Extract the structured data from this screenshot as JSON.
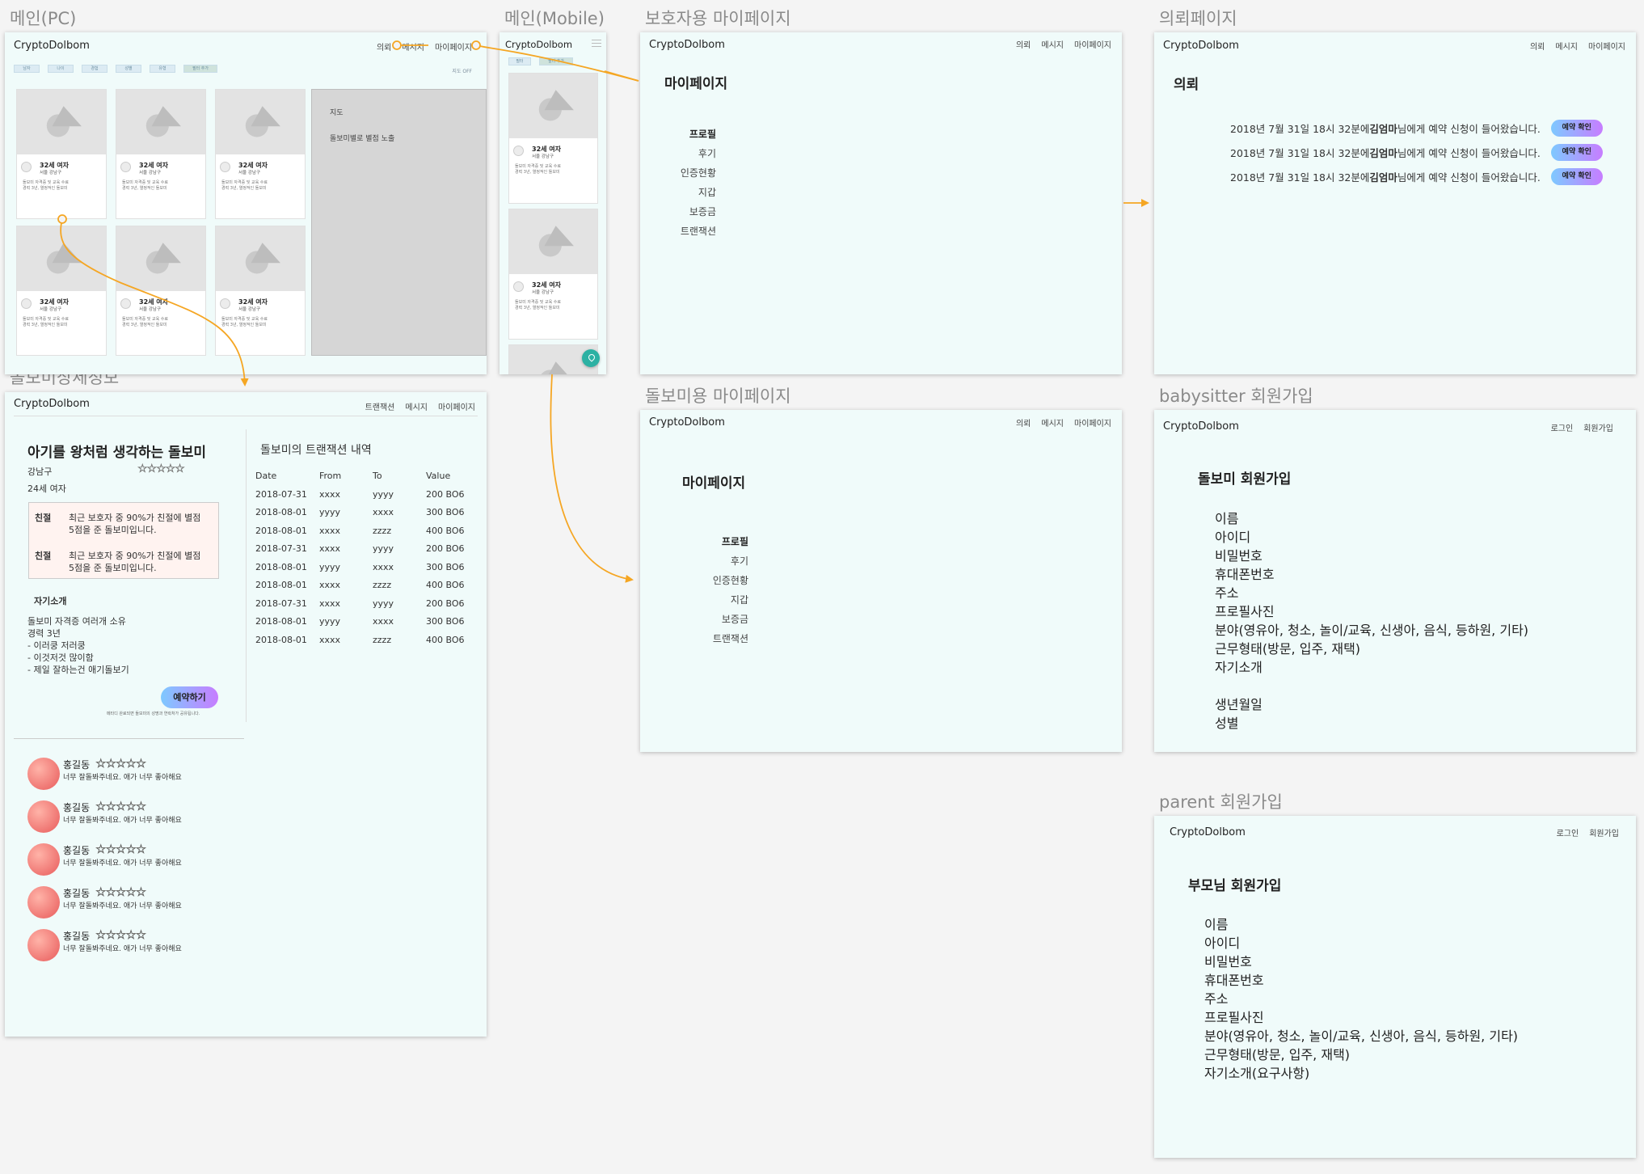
{
  "artboard_labels": {
    "main_pc": "메인(PC)",
    "main_mobile": "메인(Mobile)",
    "guardian_mypage": "보호자용 마이페이지",
    "request_page": "의뢰페이지",
    "sitter_detail": "돌보미상세정보",
    "sitter_mypage": "돌보미용 마이페이지",
    "babysitter_signup": "babysitter 회원가입",
    "parent_signup": "parent 회원가입"
  },
  "brand": "CryptoDolbom",
  "nav": {
    "request": "의뢰",
    "message": "메시지",
    "mypage": "마이페이지",
    "transaction": "트랜잭션",
    "login": "로그인",
    "signup": "회원가입"
  },
  "main_pc": {
    "filters": [
      "남자",
      "나이",
      "경험",
      "성별",
      "유형",
      "필터 추가"
    ],
    "toggle": "지도 OFF",
    "card": {
      "title": "32세 여자",
      "location": "서울 강남구",
      "desc1": "돌보미 자격증 및 교육 수료",
      "desc2": "경력 3년, 열정적인 돌보미"
    },
    "map": {
      "title": "지도",
      "note": "돌보미별로 별점 노출"
    }
  },
  "main_mobile": {
    "filters": [
      "필터",
      "필터 추가"
    ],
    "card": {
      "title": "32세 여자",
      "location": "서울 강남구",
      "desc1": "돌보미 자격증 및 교육 수료",
      "desc2": "경력 3년, 열정적인 돌보미"
    }
  },
  "mypage": {
    "title": "마이페이지",
    "menu": [
      "프로필",
      "후기",
      "인증현황",
      "지갑",
      "보증금",
      "트랜잭션"
    ]
  },
  "request_page": {
    "title": "의뢰",
    "rows": [
      {
        "pre": "2018년 7월 31일 18시 32분에 ",
        "name": "김엄마",
        "post": "님에게 예약 신청이 들어왔습니다.",
        "button": "예약 확인"
      },
      {
        "pre": "2018년 7월 31일 18시 32분에 ",
        "name": "김엄마",
        "post": "님에게 예약 신청이 들어왔습니다.",
        "button": "예약 확인"
      },
      {
        "pre": "2018년 7월 31일 18시 32분에 ",
        "name": "김엄마",
        "post": "님에게 예약 신청이 들어왔습니다.",
        "button": "예약 확인"
      }
    ]
  },
  "detail": {
    "headline": "아기를 왕처럼 생각하는 돌보미",
    "location": "강남구",
    "age_gender": "24세 여자",
    "rating_stars": 5,
    "notes": [
      {
        "tag": "친절",
        "line1": "최근 보호자 중 90%가 친절에 별점",
        "line2": "5점을 준 돌보미입니다."
      },
      {
        "tag": "친절",
        "line1": "최근 보호자 중 90%가 친절에 별점",
        "line2": "5점을 준 돌보미입니다."
      }
    ],
    "intro_title": "자기소개",
    "intro_lines": [
      "돌보미 자격증 여러개 소유",
      "경력 3년",
      "- 이러쿵 저러쿵",
      "- 이것저것 많이함",
      "- 제일 잘하는건 애기돌보기"
    ],
    "book_button": "예약하기",
    "book_note": "메타디 완료되면 돌보미의 성명과 연락처가 공유됩니다.",
    "tx_title": "돌보미의 트랜잭션 내역",
    "tx_headers": [
      "Date",
      "From",
      "To",
      "Value"
    ],
    "tx_rows": [
      [
        "2018-07-31",
        "xxxx",
        "yyyy",
        "200 BO6"
      ],
      [
        "2018-08-01",
        "yyyy",
        "xxxx",
        "300 BO6"
      ],
      [
        "2018-08-01",
        "xxxx",
        "zzzz",
        "400 BO6"
      ],
      [
        "2018-07-31",
        "xxxx",
        "yyyy",
        "200 BO6"
      ],
      [
        "2018-08-01",
        "yyyy",
        "xxxx",
        "300 BO6"
      ],
      [
        "2018-08-01",
        "xxxx",
        "zzzz",
        "400 BO6"
      ],
      [
        "2018-07-31",
        "xxxx",
        "yyyy",
        "200 BO6"
      ],
      [
        "2018-08-01",
        "yyyy",
        "xxxx",
        "300 BO6"
      ],
      [
        "2018-08-01",
        "xxxx",
        "zzzz",
        "400 BO6"
      ]
    ],
    "reviews": [
      {
        "name": "홍길동",
        "comment": "너무 잘돌봐주네요. 애가 너무 좋아해요",
        "stars": 5
      },
      {
        "name": "홍길동",
        "comment": "너무 잘돌봐주네요. 애가 너무 좋아해요",
        "stars": 5
      },
      {
        "name": "홍길동",
        "comment": "너무 잘돌봐주네요. 애가 너무 좋아해요",
        "stars": 5
      },
      {
        "name": "홍길동",
        "comment": "너무 잘돌봐주네요. 애가 너무 좋아해요",
        "stars": 5
      },
      {
        "name": "홍길동",
        "comment": "너무 잘돌봐주네요. 애가 너무 좋아해요",
        "stars": 5
      }
    ]
  },
  "sitter_signup": {
    "title": "돌보미 회원가입",
    "fields": [
      "이름",
      "아이디",
      "비밀번호",
      "휴대폰번호",
      "주소",
      "프로필사진",
      "분야(영유아, 청소, 놀이/교육, 신생아, 음식, 등하원, 기타)",
      "근무형태(방문, 입주, 재택)",
      "자기소개",
      "",
      "생년월일",
      "성별"
    ]
  },
  "parent_signup": {
    "title": "부모님 회원가입",
    "fields": [
      "이름",
      "아이디",
      "비밀번호",
      "휴대폰번호",
      "주소",
      "프로필사진",
      "분야(영유아, 청소, 놀이/교육, 신생아, 음식, 등하원, 기타)",
      "근무형태(방문, 입주, 재택)",
      "자기소개(요구사항)"
    ]
  },
  "colors": {
    "board_bg": "#f0fbfa",
    "connector": "#f5a623",
    "button_gradient_start": "#7ec9ff",
    "button_gradient_end": "#c77dff",
    "fab": "#2cb1a3"
  }
}
